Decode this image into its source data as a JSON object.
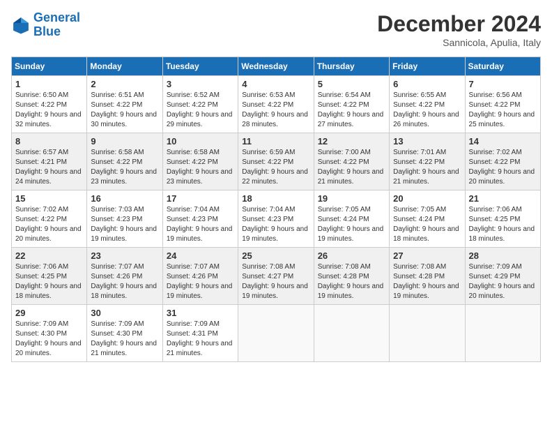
{
  "header": {
    "logo_line1": "General",
    "logo_line2": "Blue",
    "month": "December 2024",
    "location": "Sannicola, Apulia, Italy"
  },
  "days_of_week": [
    "Sunday",
    "Monday",
    "Tuesday",
    "Wednesday",
    "Thursday",
    "Friday",
    "Saturday"
  ],
  "weeks": [
    [
      {
        "day": "1",
        "sunrise": "6:50 AM",
        "sunset": "4:22 PM",
        "daylight": "9 hours and 32 minutes."
      },
      {
        "day": "2",
        "sunrise": "6:51 AM",
        "sunset": "4:22 PM",
        "daylight": "9 hours and 30 minutes."
      },
      {
        "day": "3",
        "sunrise": "6:52 AM",
        "sunset": "4:22 PM",
        "daylight": "9 hours and 29 minutes."
      },
      {
        "day": "4",
        "sunrise": "6:53 AM",
        "sunset": "4:22 PM",
        "daylight": "9 hours and 28 minutes."
      },
      {
        "day": "5",
        "sunrise": "6:54 AM",
        "sunset": "4:22 PM",
        "daylight": "9 hours and 27 minutes."
      },
      {
        "day": "6",
        "sunrise": "6:55 AM",
        "sunset": "4:22 PM",
        "daylight": "9 hours and 26 minutes."
      },
      {
        "day": "7",
        "sunrise": "6:56 AM",
        "sunset": "4:22 PM",
        "daylight": "9 hours and 25 minutes."
      }
    ],
    [
      {
        "day": "8",
        "sunrise": "6:57 AM",
        "sunset": "4:21 PM",
        "daylight": "9 hours and 24 minutes."
      },
      {
        "day": "9",
        "sunrise": "6:58 AM",
        "sunset": "4:22 PM",
        "daylight": "9 hours and 23 minutes."
      },
      {
        "day": "10",
        "sunrise": "6:58 AM",
        "sunset": "4:22 PM",
        "daylight": "9 hours and 23 minutes."
      },
      {
        "day": "11",
        "sunrise": "6:59 AM",
        "sunset": "4:22 PM",
        "daylight": "9 hours and 22 minutes."
      },
      {
        "day": "12",
        "sunrise": "7:00 AM",
        "sunset": "4:22 PM",
        "daylight": "9 hours and 21 minutes."
      },
      {
        "day": "13",
        "sunrise": "7:01 AM",
        "sunset": "4:22 PM",
        "daylight": "9 hours and 21 minutes."
      },
      {
        "day": "14",
        "sunrise": "7:02 AM",
        "sunset": "4:22 PM",
        "daylight": "9 hours and 20 minutes."
      }
    ],
    [
      {
        "day": "15",
        "sunrise": "7:02 AM",
        "sunset": "4:22 PM",
        "daylight": "9 hours and 20 minutes."
      },
      {
        "day": "16",
        "sunrise": "7:03 AM",
        "sunset": "4:23 PM",
        "daylight": "9 hours and 19 minutes."
      },
      {
        "day": "17",
        "sunrise": "7:04 AM",
        "sunset": "4:23 PM",
        "daylight": "9 hours and 19 minutes."
      },
      {
        "day": "18",
        "sunrise": "7:04 AM",
        "sunset": "4:23 PM",
        "daylight": "9 hours and 19 minutes."
      },
      {
        "day": "19",
        "sunrise": "7:05 AM",
        "sunset": "4:24 PM",
        "daylight": "9 hours and 19 minutes."
      },
      {
        "day": "20",
        "sunrise": "7:05 AM",
        "sunset": "4:24 PM",
        "daylight": "9 hours and 18 minutes."
      },
      {
        "day": "21",
        "sunrise": "7:06 AM",
        "sunset": "4:25 PM",
        "daylight": "9 hours and 18 minutes."
      }
    ],
    [
      {
        "day": "22",
        "sunrise": "7:06 AM",
        "sunset": "4:25 PM",
        "daylight": "9 hours and 18 minutes."
      },
      {
        "day": "23",
        "sunrise": "7:07 AM",
        "sunset": "4:26 PM",
        "daylight": "9 hours and 18 minutes."
      },
      {
        "day": "24",
        "sunrise": "7:07 AM",
        "sunset": "4:26 PM",
        "daylight": "9 hours and 19 minutes."
      },
      {
        "day": "25",
        "sunrise": "7:08 AM",
        "sunset": "4:27 PM",
        "daylight": "9 hours and 19 minutes."
      },
      {
        "day": "26",
        "sunrise": "7:08 AM",
        "sunset": "4:28 PM",
        "daylight": "9 hours and 19 minutes."
      },
      {
        "day": "27",
        "sunrise": "7:08 AM",
        "sunset": "4:28 PM",
        "daylight": "9 hours and 19 minutes."
      },
      {
        "day": "28",
        "sunrise": "7:09 AM",
        "sunset": "4:29 PM",
        "daylight": "9 hours and 20 minutes."
      }
    ],
    [
      {
        "day": "29",
        "sunrise": "7:09 AM",
        "sunset": "4:30 PM",
        "daylight": "9 hours and 20 minutes."
      },
      {
        "day": "30",
        "sunrise": "7:09 AM",
        "sunset": "4:30 PM",
        "daylight": "9 hours and 21 minutes."
      },
      {
        "day": "31",
        "sunrise": "7:09 AM",
        "sunset": "4:31 PM",
        "daylight": "9 hours and 21 minutes."
      },
      null,
      null,
      null,
      null
    ]
  ]
}
